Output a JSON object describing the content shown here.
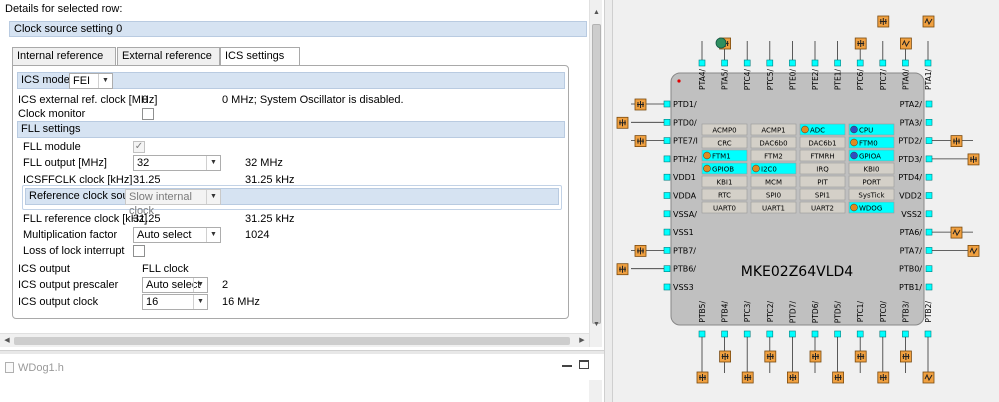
{
  "details": {
    "title": "Details for selected row:",
    "group_label": "Clock source setting 0",
    "tabs": [
      {
        "label": "Internal reference clock"
      },
      {
        "label": "External reference clock"
      },
      {
        "label": "ICS settings"
      }
    ],
    "ics_mode": {
      "label": "ICS mode",
      "value": "FEI"
    },
    "ics_ext_clock": {
      "label": "ICS external ref. clock [MHz]",
      "value": "0",
      "info": "0 MHz; System Oscillator is disabled."
    },
    "clock_monitor": {
      "label": "Clock monitor"
    },
    "fll_settings": {
      "header": "FLL settings",
      "fll_module": {
        "label": "FLL module",
        "check": "✓"
      },
      "fll_output": {
        "label": "FLL output [MHz]",
        "value": "32",
        "info": "32 MHz"
      },
      "icsffclk": {
        "label": "ICSFFCLK clock [kHz]",
        "value": "31.25",
        "info": "31.25 kHz"
      },
      "ref_source": {
        "label": "Reference clock source",
        "value": "Slow internal clock"
      },
      "fll_ref_clock": {
        "label": "FLL reference clock [kHz]",
        "value": "31.25",
        "info": "31.25 kHz"
      },
      "mult_factor": {
        "label": "Multiplication factor",
        "value": "Auto select",
        "info": "1024"
      },
      "loss_of_lock": {
        "label": "Loss of lock interrupt"
      }
    },
    "ics_output": {
      "label": "ICS output",
      "value": "FLL clock"
    },
    "ics_prescaler": {
      "label": "ICS output prescaler",
      "value": "Auto select",
      "info": "2"
    },
    "ics_output_clock": {
      "label": "ICS output clock",
      "value": "16",
      "info": "16 MHz"
    }
  },
  "editor": {
    "tab_label": "WDog1.h"
  },
  "chip": {
    "name": "MKE02Z64VLD4",
    "colors": {
      "body": "#c0c0c0",
      "pin": "#00ffff",
      "active": "#00ffff",
      "module": "#d4d0c8",
      "icon": "#f0a040"
    },
    "top_pins": [
      "PTA4/",
      "PTA5/",
      "PTC4/",
      "PTC5/",
      "PTE0/",
      "PTE2/",
      "PTE1/",
      "PTC6/",
      "PTC7/",
      "PTA0/",
      "PTA1/"
    ],
    "bottom_pins": [
      "PTB5/",
      "PTB4/",
      "PTC3/",
      "PTC2/",
      "PTD7/",
      "PTD6/",
      "PTD5/",
      "PTC1/",
      "PTC0/",
      "PTB3/",
      "PTB2/"
    ],
    "left_pins": [
      "PTD1/",
      "PTD0/",
      "PTE7/I",
      "PTH2/",
      "VDD1",
      "VDDA",
      "VSSA/",
      "VSS1",
      "PTB7/",
      "PTB6/",
      "VSS3"
    ],
    "right_pins": [
      "PTA2/",
      "PTA3/",
      "PTD2/",
      "PTD3/",
      "PTD4/",
      "VDD2",
      "VSS2",
      "PTA6/",
      "PTA7/",
      "PTB0/",
      "PTB1/"
    ],
    "modules": [
      {
        "label": "ACMP0",
        "active": false,
        "icon": ""
      },
      {
        "label": "ACMP1",
        "active": false,
        "icon": ""
      },
      {
        "label": "ADC",
        "active": true,
        "icon": "wave-icon"
      },
      {
        "label": "CPU",
        "active": true,
        "icon": "gear-icon"
      },
      {
        "label": "CRC",
        "active": false,
        "icon": ""
      },
      {
        "label": "DAC6b0",
        "active": false,
        "icon": ""
      },
      {
        "label": "DAC6b1",
        "active": false,
        "icon": ""
      },
      {
        "label": "FTM0",
        "active": true,
        "icon": "timer-icon"
      },
      {
        "label": "FTM1",
        "active": true,
        "icon": "timer-icon"
      },
      {
        "label": "FTM2",
        "active": false,
        "icon": ""
      },
      {
        "label": "FTMRH",
        "active": false,
        "icon": ""
      },
      {
        "label": "GPIOA",
        "active": true,
        "icon": "io-icon"
      },
      {
        "label": "GPIOB",
        "active": true,
        "icon": "chip-icon"
      },
      {
        "label": "I2C0",
        "active": true,
        "icon": "chip-icon"
      },
      {
        "label": "IRQ",
        "active": false,
        "icon": ""
      },
      {
        "label": "KBI0",
        "active": false,
        "icon": ""
      },
      {
        "label": "KBI1",
        "active": false,
        "icon": ""
      },
      {
        "label": "MCM",
        "active": false,
        "icon": ""
      },
      {
        "label": "PIT",
        "active": false,
        "icon": ""
      },
      {
        "label": "PORT",
        "active": false,
        "icon": ""
      },
      {
        "label": "RTC",
        "active": false,
        "icon": ""
      },
      {
        "label": "SPI0",
        "active": false,
        "icon": ""
      },
      {
        "label": "SPI1",
        "active": false,
        "icon": ""
      },
      {
        "label": "SysTick",
        "active": false,
        "icon": ""
      },
      {
        "label": "UART0",
        "active": false,
        "icon": ""
      },
      {
        "label": "UART1",
        "active": false,
        "icon": ""
      },
      {
        "label": "UART2",
        "active": false,
        "icon": ""
      },
      {
        "label": "WDOG",
        "active": true,
        "icon": "chip-icon"
      }
    ]
  }
}
